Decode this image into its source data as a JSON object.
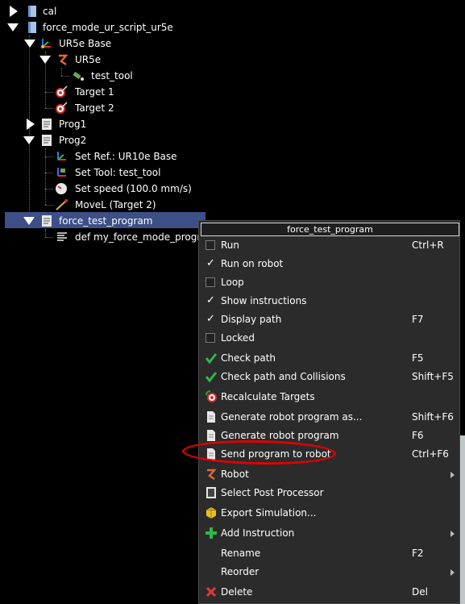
{
  "tree": {
    "items": [
      {
        "label": "cal"
      },
      {
        "label": "force_mode_ur_script_ur5e"
      },
      {
        "label": "UR5e Base"
      },
      {
        "label": "UR5e"
      },
      {
        "label": "test_tool"
      },
      {
        "label": "Target 1"
      },
      {
        "label": "Target 2"
      },
      {
        "label": "Prog1"
      },
      {
        "label": "Prog2"
      },
      {
        "label": "Set Ref.: UR10e Base"
      },
      {
        "label": "Set Tool: test_tool"
      },
      {
        "label": "Set speed (100.0 mm/s)"
      },
      {
        "label": "MoveL (Target 2)"
      },
      {
        "label": "force_test_program"
      },
      {
        "label": "def my_force_mode_progra..."
      }
    ]
  },
  "menu": {
    "title": "force_test_program",
    "items": [
      {
        "label": "Run",
        "shortcut": "Ctrl+R"
      },
      {
        "label": "Run on robot",
        "shortcut": ""
      },
      {
        "label": "Loop",
        "shortcut": ""
      },
      {
        "label": "Show instructions",
        "shortcut": ""
      },
      {
        "label": "Display path",
        "shortcut": "F7"
      },
      {
        "label": "Locked",
        "shortcut": ""
      },
      {
        "label": "Check path",
        "shortcut": "F5"
      },
      {
        "label": "Check path and Collisions",
        "shortcut": "Shift+F5"
      },
      {
        "label": "Recalculate Targets",
        "shortcut": ""
      },
      {
        "label": "Generate robot program as...",
        "shortcut": "Shift+F6"
      },
      {
        "label": "Generate robot program",
        "shortcut": "F6"
      },
      {
        "label": "Send program to robot",
        "shortcut": "Ctrl+F6"
      },
      {
        "label": "Robot",
        "shortcut": ""
      },
      {
        "label": "Select Post Processor",
        "shortcut": ""
      },
      {
        "label": "Export Simulation...",
        "shortcut": ""
      },
      {
        "label": "Add Instruction",
        "shortcut": ""
      },
      {
        "label": "Rename",
        "shortcut": "F2"
      },
      {
        "label": "Reorder",
        "shortcut": ""
      },
      {
        "label": "Delete",
        "shortcut": "Del"
      }
    ],
    "check_mark": "✓"
  },
  "colors": {
    "selection": "#3c4f86",
    "annotation": "#e30000",
    "check_green": "#2fb84a"
  }
}
